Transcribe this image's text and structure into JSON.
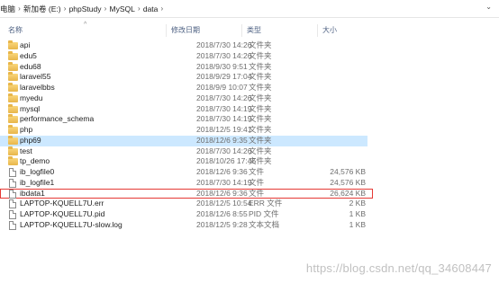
{
  "breadcrumb": {
    "items": [
      "电脑",
      "新加卷 (E:)",
      "phpStudy",
      "MySQL",
      "data"
    ]
  },
  "columns": {
    "name": "名称",
    "date": "修改日期",
    "type": "类型",
    "size": "大小"
  },
  "files": [
    {
      "name": "api",
      "date": "2018/7/30 14:26",
      "type": "文件夹",
      "size": "",
      "kind": "folder"
    },
    {
      "name": "edu5",
      "date": "2018/7/30 14:26",
      "type": "文件夹",
      "size": "",
      "kind": "folder"
    },
    {
      "name": "edu68",
      "date": "2018/9/30 9:51",
      "type": "文件夹",
      "size": "",
      "kind": "folder"
    },
    {
      "name": "laravel55",
      "date": "2018/9/29 17:04",
      "type": "文件夹",
      "size": "",
      "kind": "folder"
    },
    {
      "name": "laravelbbs",
      "date": "2018/9/9 10:07",
      "type": "文件夹",
      "size": "",
      "kind": "folder"
    },
    {
      "name": "myedu",
      "date": "2018/7/30 14:26",
      "type": "文件夹",
      "size": "",
      "kind": "folder"
    },
    {
      "name": "mysql",
      "date": "2018/7/30 14:19",
      "type": "文件夹",
      "size": "",
      "kind": "folder"
    },
    {
      "name": "performance_schema",
      "date": "2018/7/30 14:19",
      "type": "文件夹",
      "size": "",
      "kind": "folder"
    },
    {
      "name": "php",
      "date": "2018/12/5 19:41",
      "type": "文件夹",
      "size": "",
      "kind": "folder"
    },
    {
      "name": "php69",
      "date": "2018/12/6 9:35",
      "type": "文件夹",
      "size": "",
      "kind": "folder",
      "selected": true
    },
    {
      "name": "test",
      "date": "2018/7/30 14:26",
      "type": "文件夹",
      "size": "",
      "kind": "folder"
    },
    {
      "name": "tp_demo",
      "date": "2018/10/26 17:45",
      "type": "文件夹",
      "size": "",
      "kind": "folder"
    },
    {
      "name": "ib_logfile0",
      "date": "2018/12/6 9:36",
      "type": "文件",
      "size": "24,576 KB",
      "kind": "file"
    },
    {
      "name": "ib_logfile1",
      "date": "2018/7/30 14:19",
      "type": "文件",
      "size": "24,576 KB",
      "kind": "file"
    },
    {
      "name": "ibdata1",
      "date": "2018/12/6 9:36",
      "type": "文件",
      "size": "26,624 KB",
      "kind": "file",
      "highlight": true
    },
    {
      "name": "LAPTOP-KQUELL7U.err",
      "date": "2018/12/5 10:54",
      "type": "ERR 文件",
      "size": "2 KB",
      "kind": "file"
    },
    {
      "name": "LAPTOP-KQUELL7U.pid",
      "date": "2018/12/6 8:55",
      "type": "PID 文件",
      "size": "1 KB",
      "kind": "file"
    },
    {
      "name": "LAPTOP-KQUELL7U-slow.log",
      "date": "2018/12/5 9:28",
      "type": "文本文档",
      "size": "1 KB",
      "kind": "file"
    }
  ],
  "watermark": "https://blog.csdn.net/qq_34608447",
  "colors": {
    "selection": "#cce8ff",
    "highlight_border": "#e53935",
    "header_text": "#4d6082",
    "folder": "#f0c75e"
  }
}
